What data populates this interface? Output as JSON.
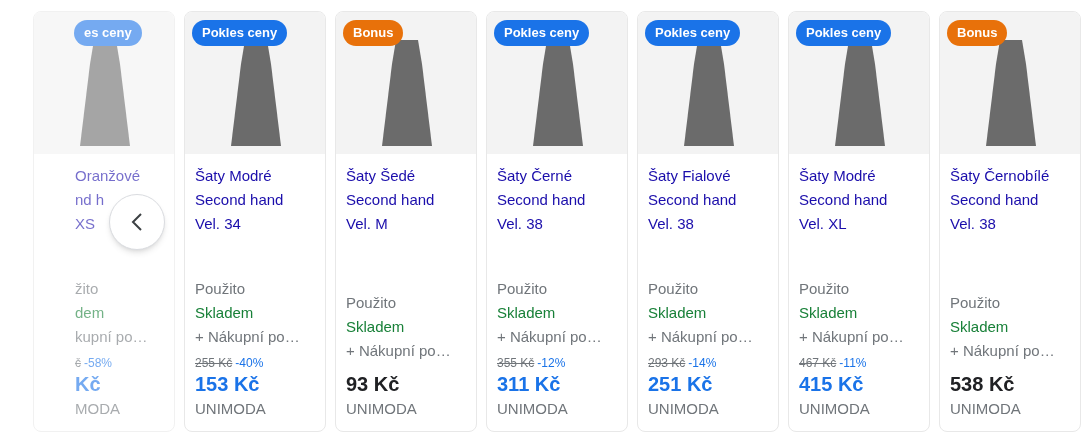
{
  "carousel": {
    "previous_button": true
  },
  "cards": [
    {
      "faded": true,
      "badge": {
        "text": "es ceny",
        "kind": "price_drop"
      },
      "title": [
        "Oranžové",
        "nd h",
        "XS"
      ],
      "condition": "žito",
      "stock": "dem",
      "shipping": "kupní po…",
      "old_price": "č",
      "discount": "-58%",
      "price": "Kč",
      "seller": "MODA"
    },
    {
      "faded": false,
      "badge": {
        "text": "Pokles ceny",
        "kind": "price_drop"
      },
      "title": [
        "Šaty Modré",
        "Second hand",
        "Vel. 34"
      ],
      "condition": "Použito",
      "stock": "Skladem",
      "shipping": "+ Nákupní po…",
      "old_price": "255 Kč",
      "discount": "-40%",
      "price": "153 Kč",
      "seller": "UNIMODA"
    },
    {
      "faded": false,
      "badge": {
        "text": "Bonus",
        "kind": "bonus"
      },
      "title": [
        "Šaty Šedé",
        "Second hand",
        "Vel. M"
      ],
      "condition": "Použito",
      "stock": "Skladem",
      "shipping": "+ Nákupní po…",
      "price": "93 Kč",
      "seller": "UNIMODA"
    },
    {
      "faded": false,
      "badge": {
        "text": "Pokles ceny",
        "kind": "price_drop"
      },
      "title": [
        "Šaty Černé",
        "Second hand",
        "Vel. 38"
      ],
      "condition": "Použito",
      "stock": "Skladem",
      "shipping": "+ Nákupní po…",
      "old_price": "355 Kč",
      "discount": "-12%",
      "price": "311 Kč",
      "seller": "UNIMODA"
    },
    {
      "faded": false,
      "badge": {
        "text": "Pokles ceny",
        "kind": "price_drop"
      },
      "title": [
        "Šaty Fialové",
        "Second hand",
        "Vel. 38"
      ],
      "condition": "Použito",
      "stock": "Skladem",
      "shipping": "+ Nákupní po…",
      "old_price": "293 Kč",
      "discount": "-14%",
      "price": "251 Kč",
      "seller": "UNIMODA"
    },
    {
      "faded": false,
      "badge": {
        "text": "Pokles ceny",
        "kind": "price_drop"
      },
      "title": [
        "Šaty Modré",
        "Second hand",
        "Vel. XL"
      ],
      "condition": "Použito",
      "stock": "Skladem",
      "shipping": "+ Nákupní po…",
      "old_price": "467 Kč",
      "discount": "-11%",
      "price": "415 Kč",
      "seller": "UNIMODA"
    },
    {
      "faded": false,
      "badge": {
        "text": "Bonus",
        "kind": "bonus"
      },
      "title": [
        "Šaty Černobílé",
        "Second hand",
        "Vel. 38"
      ],
      "condition": "Použito",
      "stock": "Skladem",
      "shipping": "+ Nákupní po…",
      "price": "538 Kč",
      "seller": "UNIMODA"
    }
  ]
}
